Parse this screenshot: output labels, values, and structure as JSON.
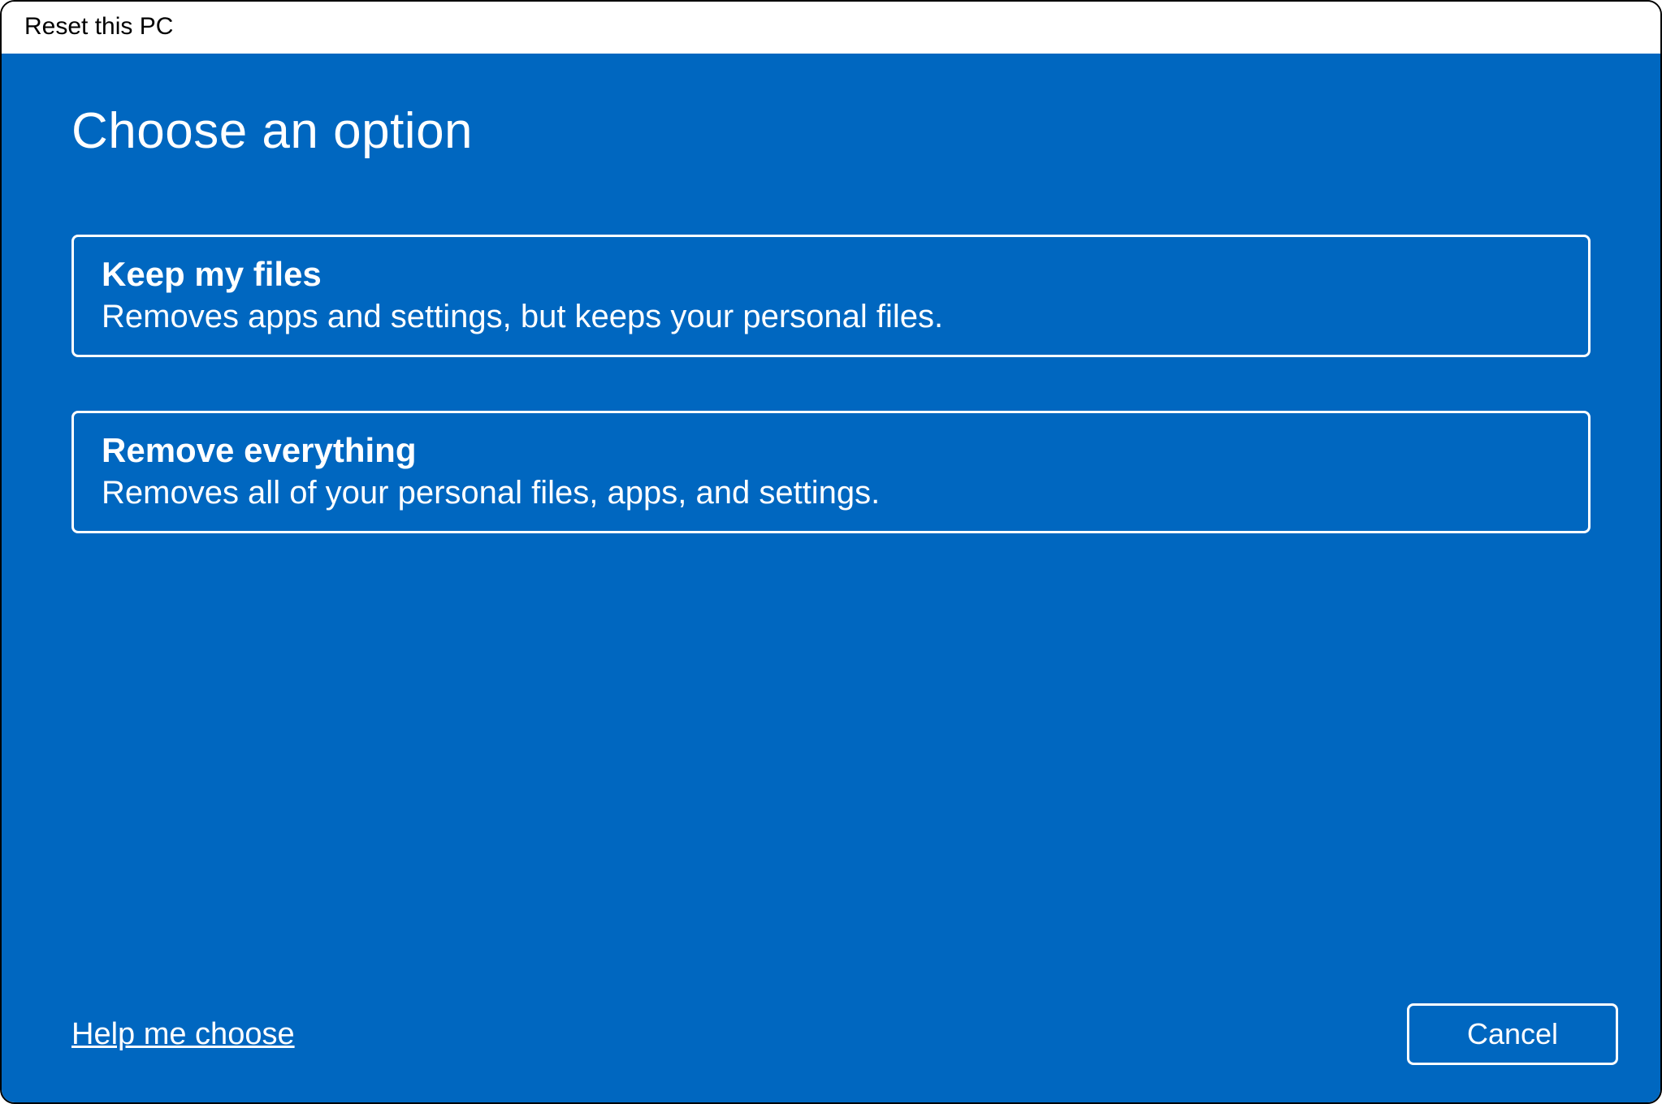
{
  "titlebar": {
    "title": "Reset this PC"
  },
  "main": {
    "heading": "Choose an option",
    "options": [
      {
        "title": "Keep my files",
        "description": "Removes apps and settings, but keeps your personal files."
      },
      {
        "title": "Remove everything",
        "description": "Removes all of your personal files, apps, and settings."
      }
    ]
  },
  "footer": {
    "help_link": "Help me choose",
    "cancel_label": "Cancel"
  },
  "colors": {
    "accent": "#0067c0",
    "text_inverse": "#ffffff"
  }
}
